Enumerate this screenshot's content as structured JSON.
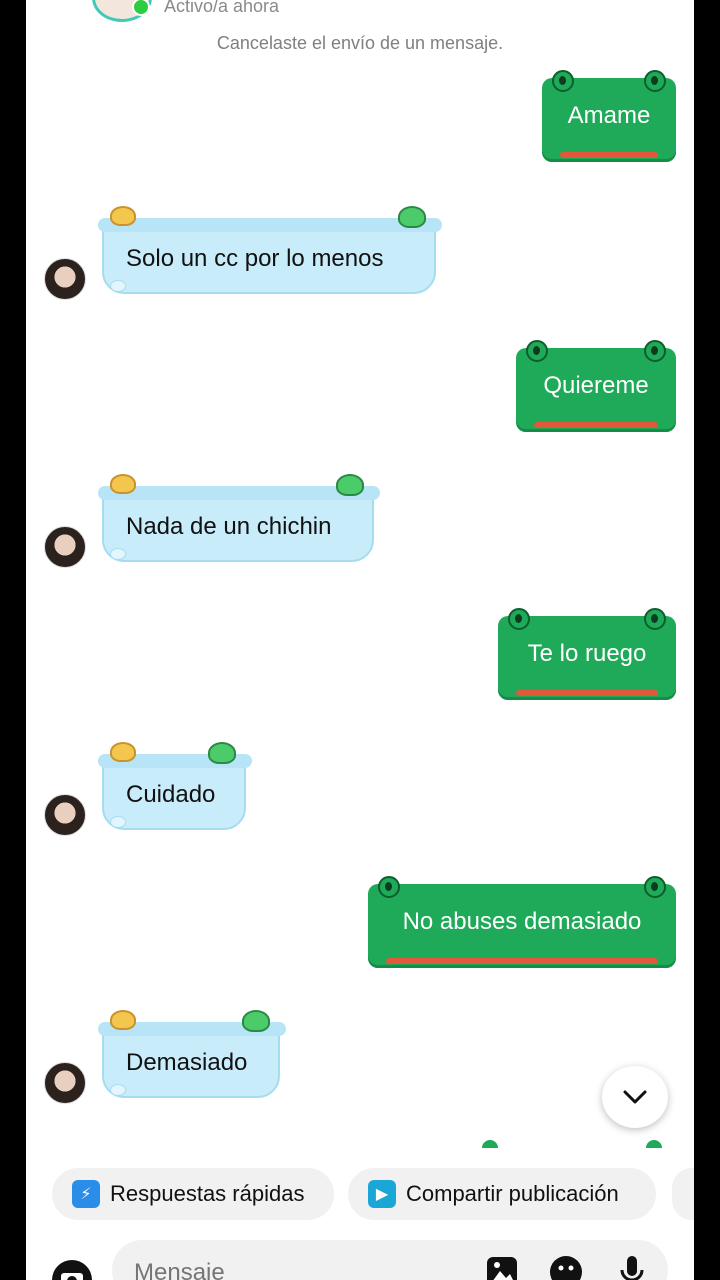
{
  "header": {
    "status": "Activo/a ahora",
    "system_note": "Cancelaste el envío de un mensaje."
  },
  "messages": [
    {
      "from": "me",
      "text": "Amame"
    },
    {
      "from": "them",
      "text": "Solo un cc por lo menos"
    },
    {
      "from": "me",
      "text": "Quiereme"
    },
    {
      "from": "them",
      "text": "Nada de un chichin"
    },
    {
      "from": "me",
      "text": "Te lo ruego"
    },
    {
      "from": "them",
      "text": "Cuidado"
    },
    {
      "from": "me",
      "text": "No abuses demasiado"
    },
    {
      "from": "them",
      "text": "Demasiado"
    }
  ],
  "quick_actions": {
    "quick_replies": "Respuestas rápidas",
    "share_post": "Compartir publicación"
  },
  "composer": {
    "placeholder": "Mensaje"
  },
  "icons": [
    "camera-icon",
    "gallery-icon",
    "sticker-icon",
    "microphone-icon",
    "chevron-down-icon"
  ],
  "colors": {
    "sent_bubble": "#1faa59",
    "received_bubble": "#c9ecfa",
    "mouth_accent": "#e2583b",
    "online_dot": "#2ecc40"
  }
}
